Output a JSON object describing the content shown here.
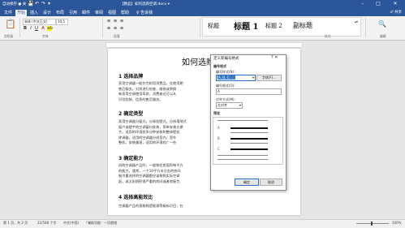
{
  "titlebar": {
    "autosave": "自动保存 ● 关",
    "qa_save": "💾",
    "qa_undo": "↶",
    "qa_redo": "↷",
    "qa_more": "▾",
    "doc_title": "【精品】如何选购空调.docx ▾",
    "min": "–",
    "max": "□",
    "close": "✕"
  },
  "tabs": [
    "文件",
    "开始",
    "插入",
    "设计",
    "布局",
    "引用",
    "邮件",
    "审阅",
    "视图",
    "帮助",
    "♀ 告诉我"
  ],
  "active_tab": 1,
  "share": "♂ 共享",
  "ribbon": {
    "paste": "📋",
    "clipboard_label": "剪贴板",
    "font_name": "宋体 (中文正文)",
    "font_size": "10.5",
    "font_label": "字体",
    "paragraph_label": "段落",
    "styles_label": "样式",
    "editing_label": "编辑",
    "bold": "B",
    "italic": "I",
    "underline": "U",
    "styles": [
      "标题",
      "标题 1",
      "标题 2",
      "副标题"
    ],
    "search": "🔍"
  },
  "document": {
    "title": "如何选购",
    "h1": "1  选择品牌",
    "p1": [
      "家用空调器一般作为耐用消费品，在使用期",
      "售后服务，对其进行检查，维修或更换",
      "新家用空调使用寿命，消费者还可以从",
      "识别包装，信息的售后服务。"
    ],
    "h2": "2  确定类型",
    "p2": [
      "家用空调器分窗式，分体挂壁式，分体落地式",
      "窗户或楼宇的空调窗口安装，简单安装方便",
      "大，适用的环境较多分种安装和整体壁挂",
      "除调器，适用的空调器分成室内，室外",
      "整机，安装美观，适用的环境较广一些"
    ],
    "h3": "3  确定能力",
    "p3": [
      "选购空调器产品时，一般按住房面积每平方",
      "的能力，通常，一个10平方米左右的房间",
      "制冷量选择的空调器都应该按照实际空调",
      "起，或太阳照射很严重的房间或者房屋为"
    ],
    "h4": "4  选择高能效比",
    "p4": [
      "空调器产品的直能耗是能源等级标识目，在"
    ]
  },
  "dialog": {
    "title": "定义新编号格式",
    "close": "?  ✕",
    "section1": "编号格式",
    "label_style": "编号样式(N):",
    "style_value": "A, B, C, ...",
    "font_button": "字体(F)...",
    "label_format": "编号格式(O):",
    "format_value": "A",
    "label_align": "对齐方式(M):",
    "align_value": "左对齐",
    "section2": "预览",
    "preview_labels": [
      "A",
      "B",
      "C"
    ],
    "ok": "确定",
    "cancel": "取消"
  },
  "statusbar": {
    "page": "第 1 页，共 2 页",
    "words": "22/548 个字",
    "lang": "中文(中国)",
    "mode": "「辅助功能：一切就绪",
    "zoom": "100%"
  }
}
